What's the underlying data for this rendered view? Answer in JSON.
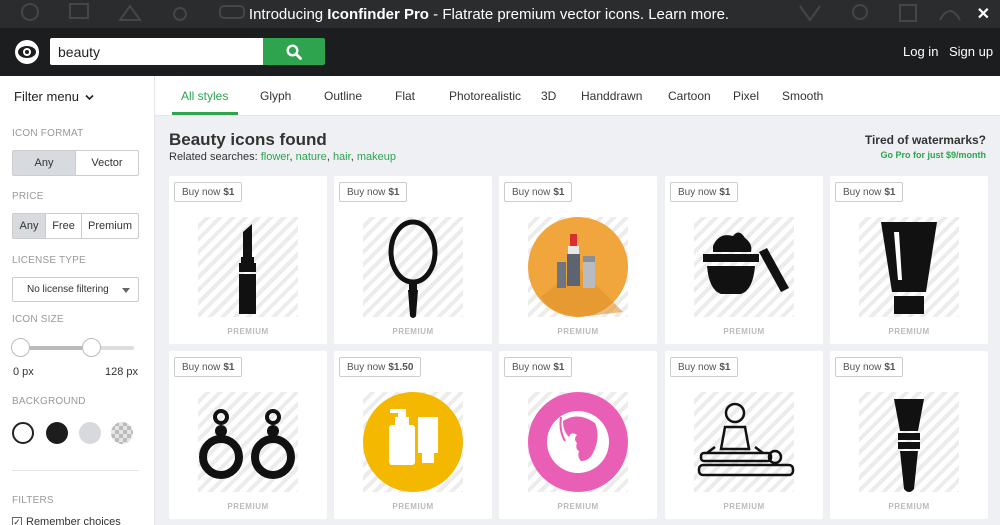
{
  "promo": {
    "intro": "Introducing ",
    "brand": "Iconfinder Pro",
    "rest": " - Flatrate premium vector icons. Learn more.",
    "close": "✕"
  },
  "header": {
    "search_value": "beauty",
    "login": "Log in",
    "signup": "Sign up"
  },
  "sidebar": {
    "filter_menu": "Filter menu",
    "icon_format": {
      "label": "ICON FORMAT",
      "options": [
        "Any",
        "Vector"
      ],
      "selected": "Any"
    },
    "price": {
      "label": "PRICE",
      "options": [
        "Any",
        "Free",
        "Premium"
      ],
      "selected": "Any"
    },
    "license": {
      "label": "LICENSE TYPE",
      "value": "No license filtering"
    },
    "icon_size": {
      "label": "ICON SIZE",
      "min_label": "0 px",
      "max_label": "128 px",
      "min": 0,
      "max": 128,
      "low": 0,
      "high": 80
    },
    "background": {
      "label": "BACKGROUND",
      "swatches": [
        "#ffffff",
        "#1d1d1d",
        "#d6d9dd",
        "checker"
      ]
    },
    "filters": {
      "label": "FILTERS",
      "remember": "Remember choices"
    }
  },
  "tabs": [
    "All styles",
    "Glyph",
    "Outline",
    "Flat",
    "Photorealistic",
    "3D",
    "Handdrawn",
    "Cartoon",
    "Pixel",
    "Smooth"
  ],
  "active_tab": "All styles",
  "results": {
    "title": "Beauty icons found",
    "related_prefix": "Related searches:",
    "related": [
      "flower",
      "nature",
      "hair",
      "makeup"
    ]
  },
  "pro_promo": {
    "heading": "Tired of watermarks?",
    "sub": "Go Pro for just $9/month"
  },
  "card_common": {
    "buy_prefix": "Buy now",
    "badge": "PREMIUM"
  },
  "cards": [
    {
      "icon": "lipstick-icon",
      "price": "$1"
    },
    {
      "icon": "hand-mirror-icon",
      "price": "$1"
    },
    {
      "icon": "makeup-set-icon",
      "price": "$1"
    },
    {
      "icon": "cream-jar-icon",
      "price": "$1"
    },
    {
      "icon": "cream-tube-icon",
      "price": "$1"
    },
    {
      "icon": "earrings-icon",
      "price": "$1"
    },
    {
      "icon": "lotion-bottles-icon",
      "price": "$1.50"
    },
    {
      "icon": "woman-face-icon",
      "price": "$1"
    },
    {
      "icon": "massage-icon",
      "price": "$1"
    },
    {
      "icon": "makeup-brush-icon",
      "price": "$1"
    }
  ],
  "colors": {
    "accent": "#2ea44f",
    "header_bg": "#1c1d1f",
    "promo_bg": "#2a2c2e",
    "page_bg": "#eef0f3"
  }
}
